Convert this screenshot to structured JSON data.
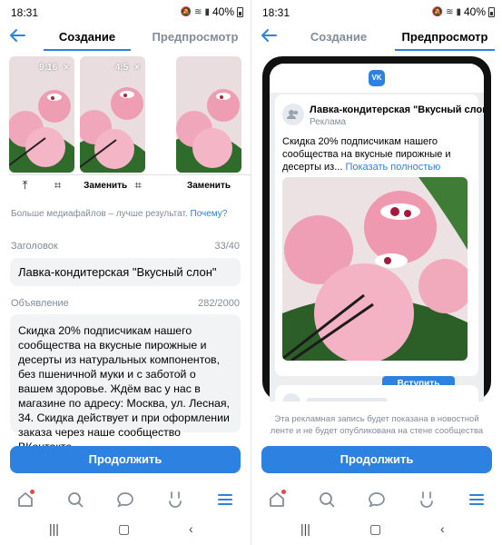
{
  "status_bar": {
    "time": "18:31",
    "battery": "40%"
  },
  "tabs": {
    "create": "Создание",
    "preview": "Предпросмотр"
  },
  "media": {
    "items": [
      {
        "ratio": "9:16",
        "action": ""
      },
      {
        "ratio": "4:5",
        "action": "Заменить"
      },
      {
        "ratio": "",
        "action": "Заменить"
      }
    ],
    "close_glyph": "×",
    "more_hint": "Больше медиафайлов – лучше результат.",
    "more_link": "Почему?"
  },
  "headline": {
    "label": "Заголовок",
    "count": "33/40",
    "value": "Лавка-кондитерская \"Вкусный слон\""
  },
  "ad": {
    "label": "Объявление",
    "count": "282/2000",
    "value": "Скидка 20% подписчикам нашего сообщества на вкусные пирожные и десерты из натуральных компонентов, без пшеничной муки и с заботой о вашем здоровье. Ждём вас у нас в магазине по адресу: Москва, ул. Лесная, 34. Скидка действует и при оформлении заказа через наше сообщество ВКонтакте."
  },
  "continue_label": "Продолжить",
  "preview": {
    "logo": "VK",
    "post_title": "Лавка-кондитерская \"Вкусный слон",
    "post_subtitle": "Реклама",
    "post_text": "Скидка 20% подписчикам нашего сообщества на вкусные пирожные и десерты из...",
    "show_more": "Показать полностью",
    "join_label": "Вступить",
    "note": "Эта рекламная запись будет показана в новостной ленте и не будет опубликована на стене сообщества"
  },
  "nav_icons": [
    "home-icon",
    "search-icon",
    "messages-icon",
    "clips-icon",
    "menu-icon"
  ],
  "colors": {
    "accent": "#2d81e0",
    "muted": "#818c99",
    "field_bg": "#f2f3f5",
    "notification": "#e64646"
  }
}
